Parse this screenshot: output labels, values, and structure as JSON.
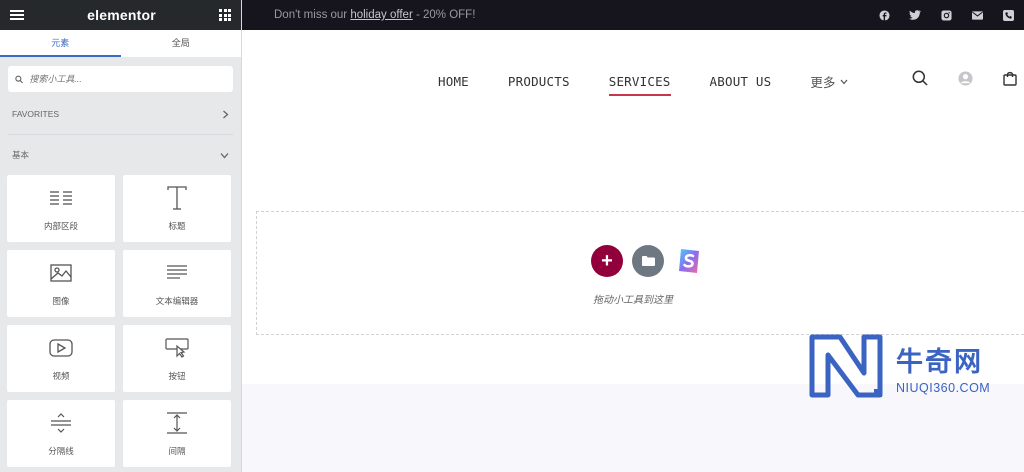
{
  "panel": {
    "logo": "elementor",
    "tabs": [
      {
        "label": "元素",
        "active": true
      },
      {
        "label": "全局",
        "active": false
      }
    ],
    "search_placeholder": "搜索小工具...",
    "favorites_label": "FAVORITES",
    "basic_label": "基本",
    "widgets": [
      {
        "label": "内部区段",
        "icon": "inner-section-icon"
      },
      {
        "label": "标题",
        "icon": "heading-icon"
      },
      {
        "label": "图像",
        "icon": "image-icon"
      },
      {
        "label": "文本编辑器",
        "icon": "text-editor-icon"
      },
      {
        "label": "视频",
        "icon": "video-icon"
      },
      {
        "label": "按钮",
        "icon": "button-icon"
      },
      {
        "label": "分隔线",
        "icon": "divider-icon"
      },
      {
        "label": "间隔",
        "icon": "spacer-icon"
      }
    ]
  },
  "topbar": {
    "promo_before": "Don't miss our ",
    "promo_link": "holiday offer",
    "promo_after": " - 20% OFF!",
    "social": [
      "facebook-icon",
      "twitter-icon",
      "instagram-icon",
      "mail-icon",
      "phone-icon"
    ]
  },
  "nav": {
    "items": [
      {
        "label": "HOME",
        "active": false
      },
      {
        "label": "PRODUCTS",
        "active": false
      },
      {
        "label": "SERVICES",
        "active": true
      },
      {
        "label": "ABOUT US",
        "active": false
      }
    ],
    "more_label": "更多"
  },
  "dropzone": {
    "text": "拖动小工具到这里"
  },
  "watermark": {
    "title": "牛奇网",
    "domain": "NIUQI360.COM"
  },
  "colors": {
    "accent": "#92003b",
    "active_underline": "#c9364b",
    "tab_active": "#3a6cc5",
    "watermark": "#3a63c2"
  }
}
